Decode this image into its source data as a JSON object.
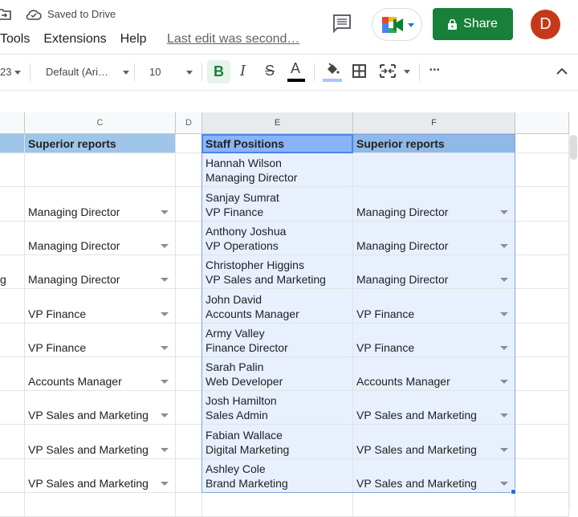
{
  "header": {
    "save_status": "Saved to Drive",
    "menu": [
      "Tools",
      "Extensions",
      "Help"
    ],
    "last_edit": "Last edit was second…",
    "share_label": "Share",
    "avatar_initial": "D"
  },
  "toolbar": {
    "number_format": "23",
    "font": "Default (Ari…",
    "font_size": "10",
    "bold": "B",
    "italic": "I",
    "strike": "S",
    "text_color": "A",
    "more": "•••"
  },
  "columns": {
    "C": "C",
    "D": "D",
    "E": "E",
    "F": "F"
  },
  "table": {
    "header": {
      "c": "Superior reports",
      "e": "Staff Positions",
      "f": "Superior reports"
    },
    "rows": [
      {
        "b": "",
        "c": "",
        "e1": "Hannah Wilson",
        "e2": "Managing Director",
        "f": ""
      },
      {
        "b": "",
        "c": "Managing Director",
        "e1": "Sanjay Sumrat",
        "e2": "VP Finance",
        "f": "Managing Director"
      },
      {
        "b": "",
        "c": "Managing Director",
        "e1": "Anthony Joshua",
        "e2": "VP Operations",
        "f": "Managing Director"
      },
      {
        "b": "g",
        "c": "Managing Director",
        "e1": "Christopher Higgins",
        "e2": "VP Sales and Marketing",
        "f": "Managing Director"
      },
      {
        "b": "",
        "c": "VP Finance",
        "e1": "John David",
        "e2": "Accounts Manager",
        "f": "VP Finance"
      },
      {
        "b": "",
        "c": "VP Finance",
        "e1": "Army Valley",
        "e2": "Finance Director",
        "f": "VP Finance"
      },
      {
        "b": "",
        "c": "Accounts Manager",
        "e1": "Sarah Palin",
        "e2": "Web Developer",
        "f": "Accounts Manager"
      },
      {
        "b": "",
        "c": "VP Sales and Marketing",
        "e1": "Josh Hamilton",
        "e2": "Sales Admin",
        "f": "VP Sales and Marketing"
      },
      {
        "b": "",
        "c": "VP Sales and Marketing",
        "e1": "Fabian Wallace",
        "e2": "Digital Marketing",
        "f": "VP Sales and Marketing"
      },
      {
        "b": "",
        "c": "VP Sales and Marketing",
        "e1": "Ashley Cole",
        "e2": "Brand Marketing",
        "f": "VP Sales and Marketing"
      }
    ]
  },
  "colors": {
    "share": "#188038",
    "avatar": "#c5391a",
    "header_fill": "#9fc5e8",
    "selection": "#e8f0fe"
  }
}
